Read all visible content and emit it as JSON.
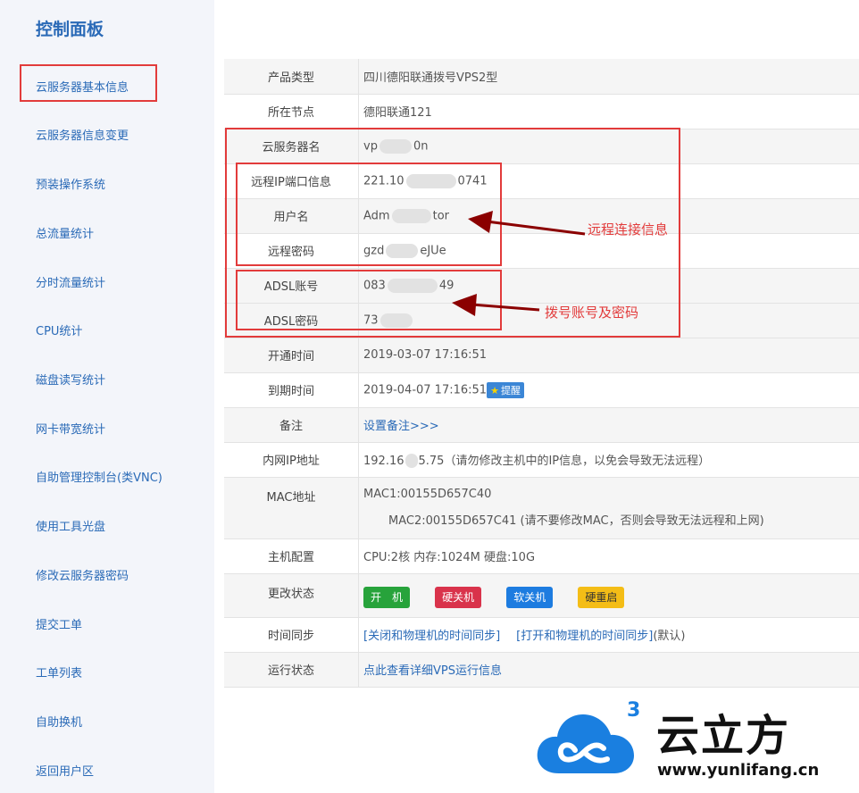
{
  "sidebar": {
    "title": "控制面板",
    "items": [
      {
        "label": "云服务器基本信息"
      },
      {
        "label": "云服务器信息变更"
      },
      {
        "label": "预装操作系统"
      },
      {
        "label": "总流量统计"
      },
      {
        "label": "分时流量统计"
      },
      {
        "label": "CPU统计"
      },
      {
        "label": "磁盘读写统计"
      },
      {
        "label": "网卡带宽统计"
      },
      {
        "label": "自助管理控制台(类VNC)"
      },
      {
        "label": "使用工具光盘"
      },
      {
        "label": "修改云服务器密码"
      },
      {
        "label": "提交工单"
      },
      {
        "label": "工单列表"
      },
      {
        "label": "自助换机"
      },
      {
        "label": "返回用户区"
      }
    ]
  },
  "info": {
    "product_type": {
      "label": "产品类型",
      "value": "四川德阳联通拨号VPS2型"
    },
    "node": {
      "label": "所在节点",
      "value": "德阳联通121"
    },
    "server_name": {
      "label": "云服务器名",
      "value_a": "vp",
      "value_b": "0n"
    },
    "remote_ip": {
      "label": "远程IP端口信息",
      "value_a": "221.10",
      "value_b": "0741"
    },
    "username": {
      "label": "用户名",
      "value_a": "Adm",
      "value_b": "tor"
    },
    "remote_password": {
      "label": "远程密码",
      "value_a": "gzd",
      "value_b": "eJUe"
    },
    "adsl_account": {
      "label": "ADSL账号",
      "value_a": "083",
      "value_b": "49"
    },
    "adsl_password": {
      "label": "ADSL密码",
      "value_a": "73",
      "value_b": ""
    },
    "open_time": {
      "label": "开通时间",
      "value": "2019-03-07 17:16:51"
    },
    "expire_time": {
      "label": "到期时间",
      "value": "2019-04-07 17:16:51",
      "remind": "提醒"
    },
    "note": {
      "label": "备注",
      "link": "设置备注>>>"
    },
    "lan_ip": {
      "label": "内网IP地址",
      "value_a": "192.16",
      "value_b": "5.75（请勿修改主机中的IP信息，以免会导致无法远程）"
    },
    "mac": {
      "label": "MAC地址",
      "mac1": "MAC1:00155D657C40",
      "mac2": "MAC2:00155D657C41 (请不要修改MAC，否则会导致无法远程和上网)"
    },
    "host_config": {
      "label": "主机配置",
      "value": "CPU:2核 内存:1024M 硬盘:10G"
    },
    "change_state": {
      "label": "更改状态",
      "buttons": [
        {
          "label": "开　机",
          "color": "#27a33b"
        },
        {
          "label": "硬关机",
          "color": "#d9334b"
        },
        {
          "label": "软关机",
          "color": "#1d7ce0"
        },
        {
          "label": "硬重启",
          "color": "#f4bd16"
        }
      ]
    },
    "time_sync": {
      "label": "时间同步",
      "link1": "[关闭和物理机的时间同步]",
      "link2": "[打开和物理机的时间同步]",
      "suffix": "(默认)"
    },
    "run_state": {
      "label": "运行状态",
      "link": "点此查看详细VPS运行信息"
    }
  },
  "annotations": {
    "remote": "远程连接信息",
    "dial": "拨号账号及密码",
    "color": "#e23b3b"
  },
  "watermark": {
    "brand": "云立方",
    "url": "www.yunlifang.cn",
    "superscript": "3",
    "color": "#1a7fe0"
  }
}
